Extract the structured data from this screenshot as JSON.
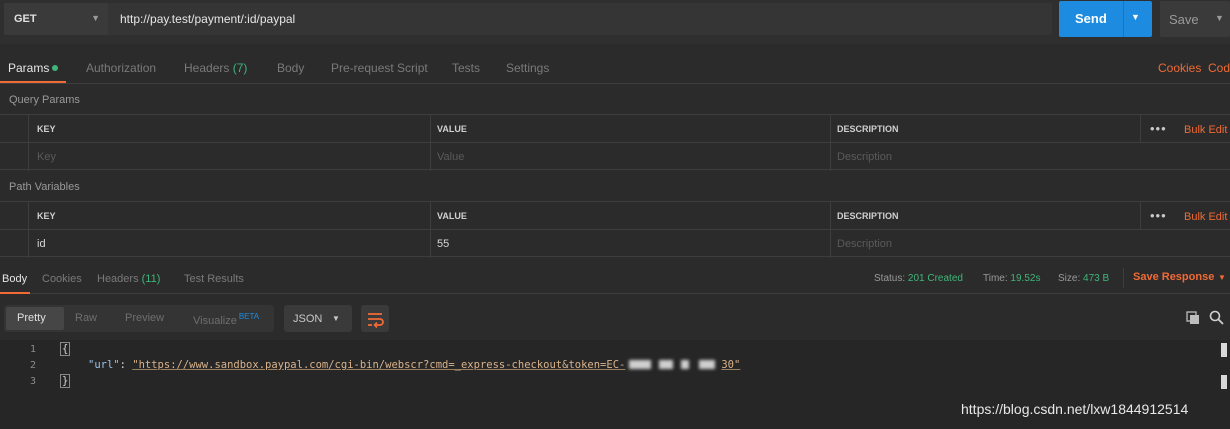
{
  "request": {
    "method": "GET",
    "url": "http://pay.test/payment/:id/paypal",
    "send_label": "Send",
    "save_label": "Save"
  },
  "request_tabs": {
    "params": "Params",
    "authorization": "Authorization",
    "headers": "Headers",
    "headers_count": "(7)",
    "body": "Body",
    "pre_request": "Pre-request Script",
    "tests": "Tests",
    "settings": "Settings",
    "cookies": "Cookies",
    "code": "Code"
  },
  "query_params": {
    "title": "Query Params",
    "columns": [
      "KEY",
      "VALUE",
      "DESCRIPTION"
    ],
    "placeholders": [
      "Key",
      "Value",
      "Description"
    ],
    "bulk_edit": "Bulk Edit"
  },
  "path_variables": {
    "title": "Path Variables",
    "columns": [
      "KEY",
      "VALUE",
      "DESCRIPTION"
    ],
    "row": {
      "key": "id",
      "value": "55",
      "description_placeholder": "Description"
    },
    "bulk_edit": "Bulk Edit"
  },
  "response_tabs": {
    "body": "Body",
    "cookies": "Cookies",
    "headers": "Headers",
    "headers_count": "(11)",
    "test_results": "Test Results"
  },
  "response_status": {
    "status_label": "Status:",
    "status_value": "201 Created",
    "time_label": "Time:",
    "time_value": "19.52s",
    "size_label": "Size:",
    "size_value": "473 B",
    "save_response": "Save Response"
  },
  "response_toolbar": {
    "pretty": "Pretty",
    "raw": "Raw",
    "preview": "Preview",
    "visualize": "Visualize",
    "beta": "BETA",
    "format": "JSON"
  },
  "code": {
    "line_numbers": [
      "1",
      "2",
      "3"
    ],
    "open_brace": "{",
    "key": "\"url\"",
    "colon": ": ",
    "value_start": "\"https://www.sandbox.paypal.com/cgi-bin/webscr?cmd=_express-checkout&token=EC-",
    "value_end": "30\"",
    "close_brace": "}"
  },
  "watermark": "https://blog.csdn.net/lxw1844912514",
  "colors": {
    "accent": "#f06a35",
    "send": "#1d8ce0",
    "success": "#3fb57a"
  }
}
